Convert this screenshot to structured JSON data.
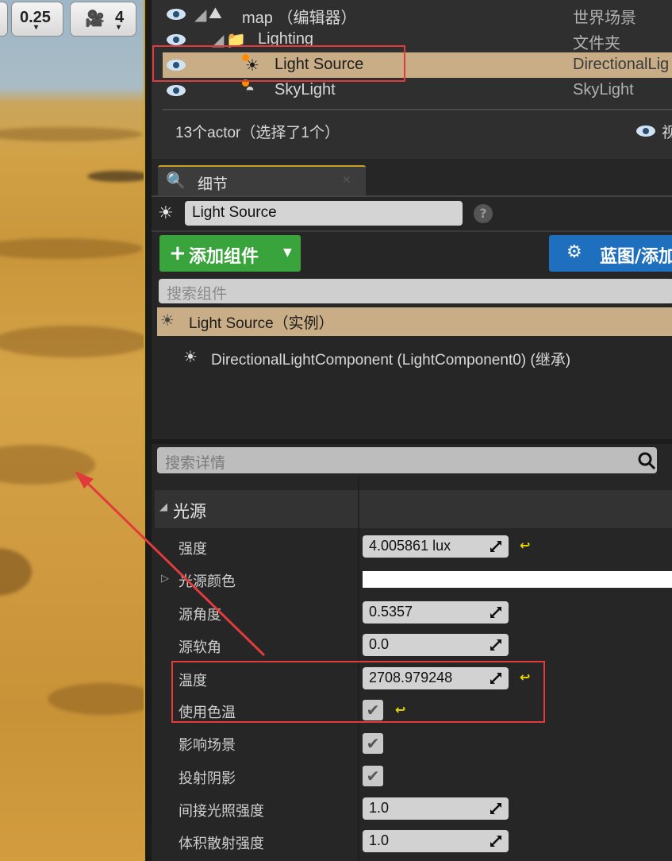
{
  "viewport": {
    "speed_value": "0.25",
    "camera_speed": "4"
  },
  "outliner": {
    "rows": [
      {
        "name": "map （编辑器）",
        "type": "世界场景"
      },
      {
        "name": "Lighting",
        "type": "文件夹"
      },
      {
        "name": "Light Source",
        "type": "DirectionalLig"
      },
      {
        "name": "SkyLight",
        "type": "SkyLight"
      }
    ],
    "status": "13个actor（选择了1个）",
    "view_options": "视"
  },
  "details": {
    "tab_label": "细节",
    "actor_name": "Light Source",
    "add_component": "添加组件",
    "blueprint_button": "蓝图/添加",
    "search_components_placeholder": "搜索组件",
    "instance_label": "Light Source（实例）",
    "component_label": "DirectionalLightComponent (LightComponent0) (继承)",
    "search_details_placeholder": "搜索详情",
    "section_title": "光源",
    "properties": [
      {
        "label": "强度",
        "value": "4.005861 lux"
      },
      {
        "label": "光源颜色",
        "value": ""
      },
      {
        "label": "源角度",
        "value": "0.5357"
      },
      {
        "label": "源软角",
        "value": "0.0"
      },
      {
        "label": "温度",
        "value": "2708.979248"
      },
      {
        "label": "使用色温",
        "value": "✔"
      },
      {
        "label": "影响场景",
        "value": "✔"
      },
      {
        "label": "投射阴影",
        "value": "✔"
      },
      {
        "label": "间接光照强度",
        "value": "1.0"
      },
      {
        "label": "体积散射强度",
        "value": "1.0"
      }
    ]
  },
  "colors": {
    "selection": "#c8ad86",
    "annotation_red": "#e23b3b",
    "add_green": "#3aa43c",
    "blueprint_blue": "#1f6fbf",
    "reset_yellow": "#e8d900"
  }
}
